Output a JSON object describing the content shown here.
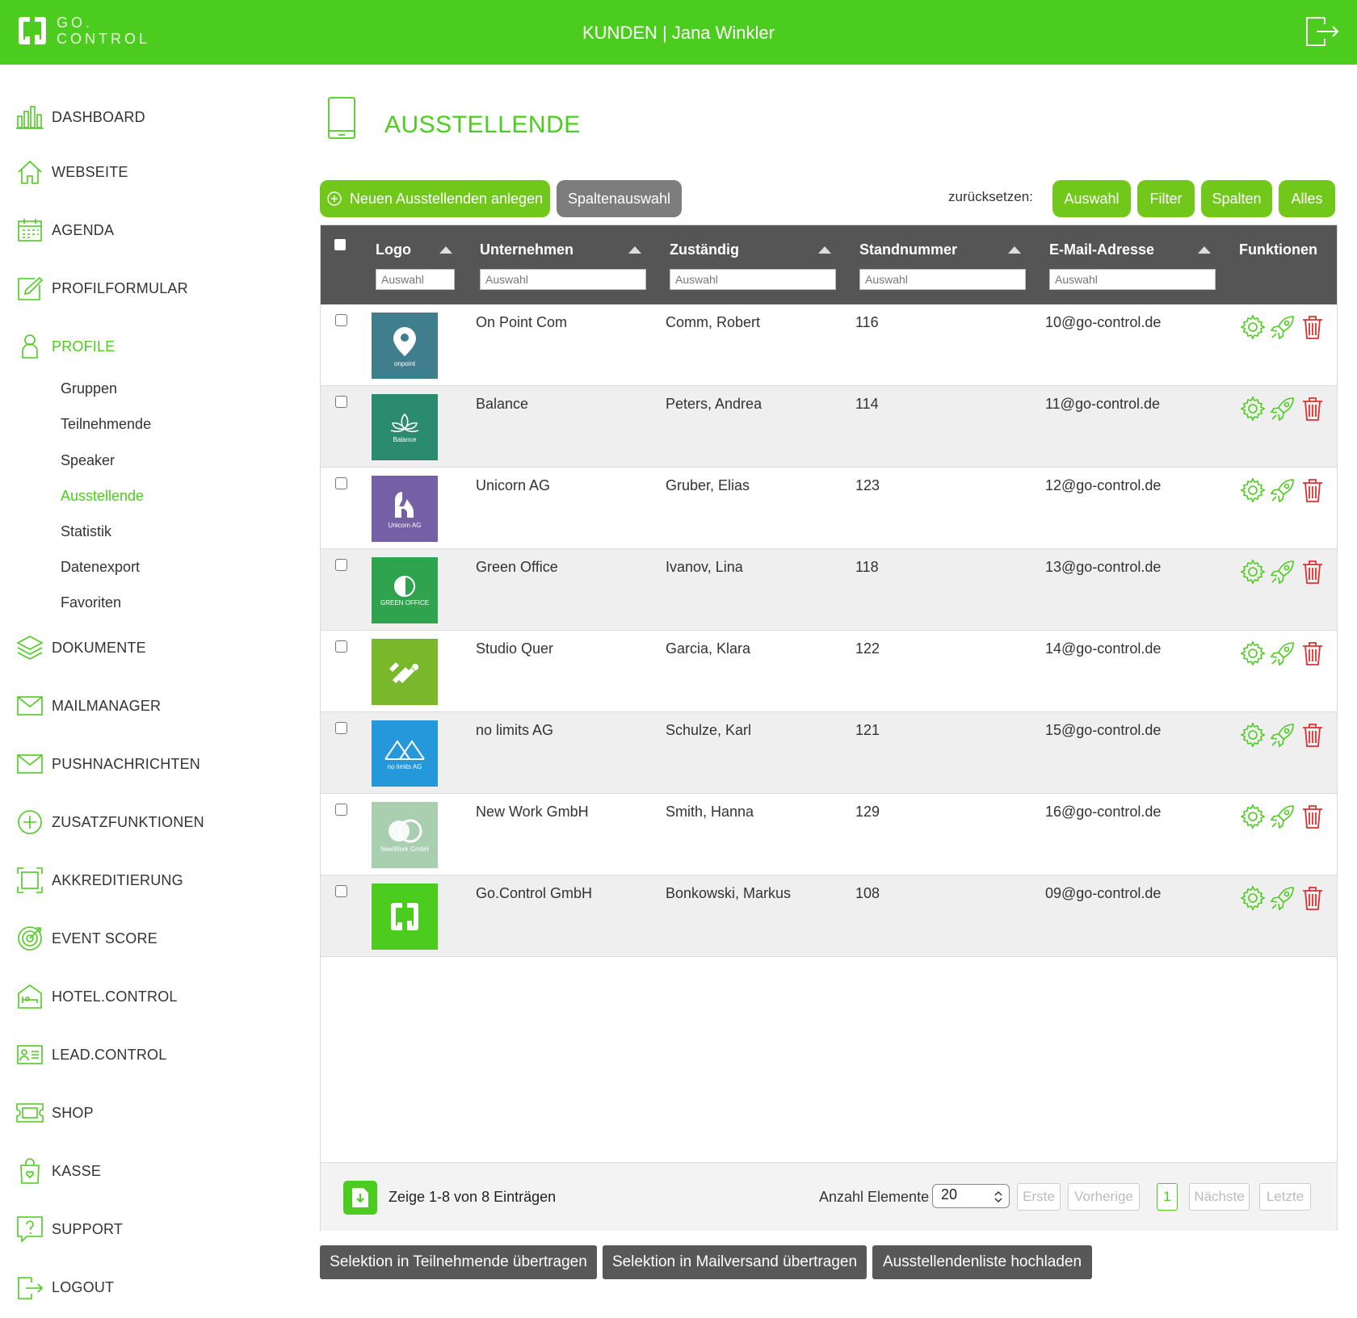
{
  "header": {
    "logo_line1": "GO.",
    "logo_line2": "CONTROL",
    "title": "KUNDEN | Jana Winkler"
  },
  "sidebar": {
    "items": [
      {
        "label": "DASHBOARD",
        "icon": "bar-chart-icon"
      },
      {
        "label": "WEBSEITE",
        "icon": "home-icon"
      },
      {
        "label": "AGENDA",
        "icon": "calendar-icon"
      },
      {
        "label": "PROFILFORMULAR",
        "icon": "edit-icon"
      },
      {
        "label": "PROFILE",
        "icon": "user-icon"
      },
      {
        "label": "DOKUMENTE",
        "icon": "layers-icon"
      },
      {
        "label": "MAILMANAGER",
        "icon": "mail-icon"
      },
      {
        "label": "PUSHNACHRICHTEN",
        "icon": "mail-icon"
      },
      {
        "label": "ZUSATZFUNKTIONEN",
        "icon": "plus-circle-icon"
      },
      {
        "label": "AKKREDITIERUNG",
        "icon": "scan-frame-icon"
      },
      {
        "label": "EVENT SCORE",
        "icon": "target-icon"
      },
      {
        "label": "HOTEL.CONTROL",
        "icon": "hotel-icon"
      },
      {
        "label": "LEAD.CONTROL",
        "icon": "id-card-icon"
      },
      {
        "label": "SHOP",
        "icon": "ticket-icon"
      },
      {
        "label": "KASSE",
        "icon": "shopping-bag-icon"
      },
      {
        "label": "SUPPORT",
        "icon": "help-icon"
      },
      {
        "label": "LOGOUT",
        "icon": "logout-icon"
      }
    ],
    "sub_items": [
      "Gruppen",
      "Teilnehmende",
      "Speaker",
      "Ausstellende",
      "Statistik",
      "Datenexport",
      "Favoriten"
    ]
  },
  "main": {
    "title": "AUSSTELLENDE",
    "new_button": "Neuen Ausstellenden anlegen",
    "columns_button": "Spaltenauswahl",
    "reset_label": "zurücksetzen:",
    "reset_buttons": [
      "Auswahl",
      "Filter",
      "Spalten",
      "Alles"
    ]
  },
  "table": {
    "headers": [
      "Logo",
      "Unternehmen",
      "Zuständig",
      "Standnummer",
      "E-Mail-Adresse",
      "Funktionen"
    ],
    "filter_placeholder": "Auswahl",
    "rows": [
      {
        "company": "On Point Com",
        "contact": "Comm, Robert",
        "stand": "116",
        "email": "10@go-control.de",
        "logo_text": "onpoint",
        "logo_color": "#3f7e8c"
      },
      {
        "company": "Balance",
        "contact": "Peters, Andrea",
        "stand": "114",
        "email": "11@go-control.de",
        "logo_text": "Balance",
        "logo_color": "#2b8b6e"
      },
      {
        "company": "Unicorn AG",
        "contact": "Gruber, Elias",
        "stand": "123",
        "email": "12@go-control.de",
        "logo_text": "Unicorn AG",
        "logo_color": "#7560a6"
      },
      {
        "company": "Green Office",
        "contact": "Ivanov, Lina",
        "stand": "118",
        "email": "13@go-control.de",
        "logo_text": "GREEN OFFICE",
        "logo_color": "#2fa34e"
      },
      {
        "company": "Studio Quer",
        "contact": "Garcia, Klara",
        "stand": "122",
        "email": "14@go-control.de",
        "logo_text": "",
        "logo_color": "#78b82a"
      },
      {
        "company": "no limits AG",
        "contact": "Schulze, Karl",
        "stand": "121",
        "email": "15@go-control.de",
        "logo_text": "no limits AG",
        "logo_color": "#2597db"
      },
      {
        "company": "New Work GmbH",
        "contact": "Smith, Hanna",
        "stand": "129",
        "email": "16@go-control.de",
        "logo_text": "NewWork GmbH",
        "logo_color": "#a9cfb0"
      },
      {
        "company": "Go.Control GmbH",
        "contact": "Bonkowski, Markus",
        "stand": "108",
        "email": "09@go-control.de",
        "logo_text": "",
        "logo_color": "#4ccc1f"
      }
    ],
    "footer_text": "Zeige 1-8 von 8 Einträgen",
    "page_size_label": "Anzahl Elemente",
    "page_size": "20",
    "pagination": [
      "Erste",
      "Vorherige",
      "1",
      "Nächste",
      "Letzte"
    ]
  },
  "bottom_buttons": [
    "Selektion in Teilnehmende übertragen",
    "Selektion in Mailversand übertragen",
    "Ausstellendenliste hochladen"
  ],
  "colors": {
    "accent": "#4ccc1f",
    "button_green": "#71c81b",
    "delete_red": "#e03131"
  }
}
